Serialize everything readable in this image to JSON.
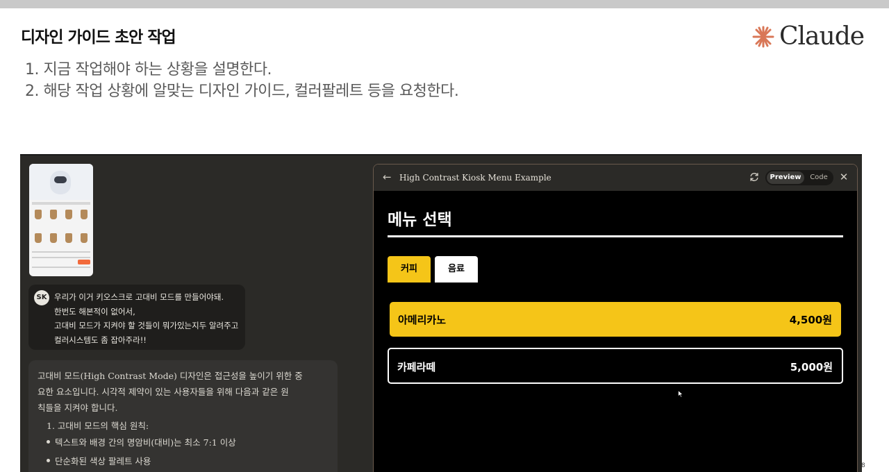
{
  "slide": {
    "title": "디자인 가이드 초안 작업",
    "bullets": [
      "1. 지금 작업해야 하는 상황을 설명한다.",
      "2. 해당 작업 상황에 알맞는 디자인 가이드, 컬러팔레트 등을 요청한다."
    ],
    "brand": "Claude",
    "brand_color": "#d97757",
    "page_number": "8"
  },
  "chat": {
    "user": {
      "avatar": "SK",
      "lines": [
        "우리가 이거 키오스크로 고대비 모드를 만들어야돼.",
        "한번도 해본적이 없어서,",
        "고대비 모드가 지켜야 할 것들이 뭐가있는지두 알려주고",
        "컬러시스템도 좀 잡아주라!!"
      ]
    },
    "assistant": {
      "lines": [
        "고대비 모드(High Contrast Mode) 디자인은 접근성을 높이기 위한 중",
        "요한 요소입니다. 시각적 제약이 있는 사용자들을 위해 다음과 같은 원",
        "칙들을 지켜야 합니다.",
        "1. 고대비 모드의 핵심 원칙:",
        "텍스트와 배경 간의 명암비(대비)는 최소 7:1 이상",
        "단순화된 색상 팔레트 사용"
      ]
    }
  },
  "artifact": {
    "title": "High Contrast Kiosk Menu Example",
    "preview_label": "Preview",
    "code_label": "Code",
    "icons": [
      "back-arrow-icon",
      "refresh-icon",
      "close-icon"
    ],
    "menu": {
      "heading": "메뉴 선택",
      "categories": [
        "커피",
        "음료"
      ],
      "items": [
        {
          "name": "아메리카노",
          "price": "4,500원"
        },
        {
          "name": "카페라떼",
          "price": "5,000원"
        }
      ],
      "accent_color": "#f5c518"
    }
  }
}
